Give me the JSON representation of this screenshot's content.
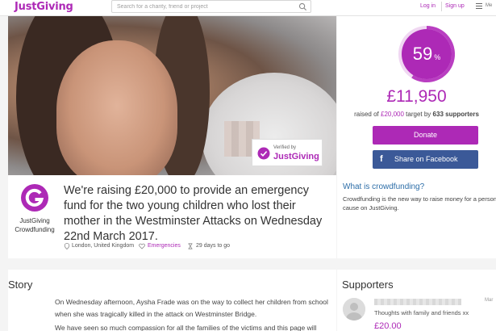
{
  "header": {
    "logo": "JustGiving",
    "search_placeholder": "Search for a charity, friend or project",
    "login": "Log in",
    "signup": "Sign up",
    "menu_label": "Me"
  },
  "hero": {
    "verified_top": "Verified by",
    "verified_brand": "JustGiving"
  },
  "donate": {
    "percent": "59",
    "percent_sign": "%",
    "progress_fraction": 0.59,
    "raised": "£11,950",
    "raised_prefix": "raised of",
    "target": "£20,000",
    "target_suffix": "target by",
    "supporters_count": "633 supporters",
    "donate_label": "Donate",
    "facebook_label": "Share on Facebook",
    "facebook_icon": "f"
  },
  "page": {
    "org_name_line1": "JustGiving",
    "org_name_line2": "Crowdfunding",
    "title": "We're raising £20,000 to provide an emergency fund for the two young children who lost their mother in the Westminster Attacks on Wednesday 22nd March 2017.",
    "location": "London, United Kingdom",
    "category": "Emergencies",
    "days_left": "29 days to go"
  },
  "crowdfunding": {
    "title": "What is crowdfunding?",
    "text": "Crowdfunding is the new way to raise money for a personal cause on JustGiving."
  },
  "story": {
    "title": "Story",
    "p1": "On Wednesday afternoon, Aysha Frade was on the way to collect her children from school when she was tragically killed in the attack on Westminster Bridge.",
    "p2": "We have seen so much compassion for all the families of the victims and this page will"
  },
  "supporters": {
    "title": "Supporters",
    "date": "Mar",
    "message": "Thoughts with family and friends xx",
    "amount": "£20.00"
  },
  "colors": {
    "brand": "#ad29b6",
    "facebook": "#3b5998",
    "link_blue": "#2d6ea8"
  }
}
